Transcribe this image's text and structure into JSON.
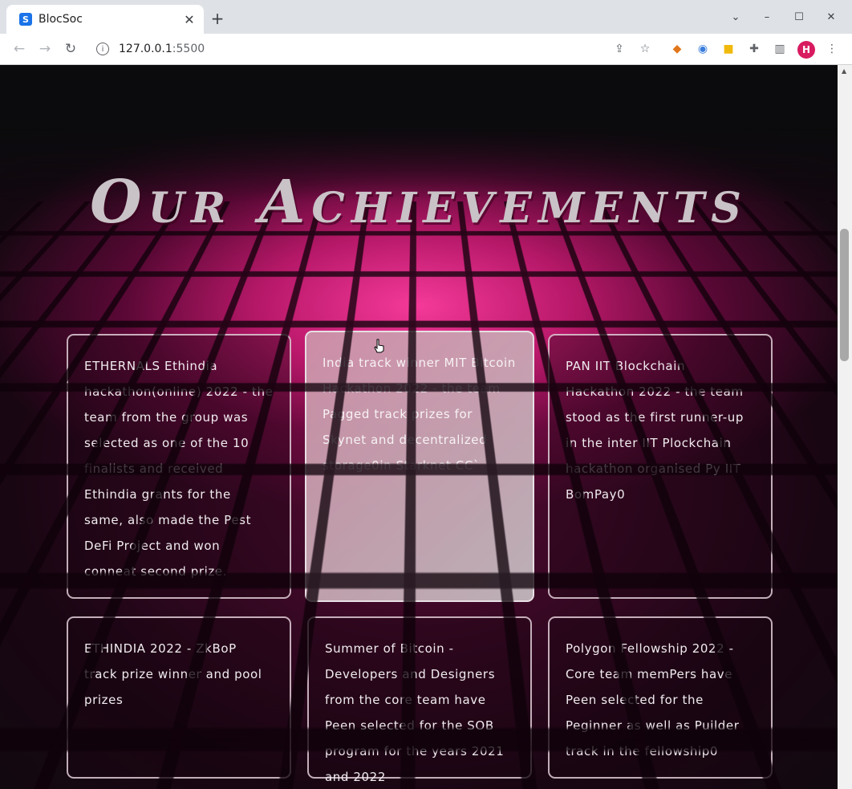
{
  "browser": {
    "tab_title": "BlocSoc",
    "tab_favicon_letter": "S",
    "url_host": "127.0.0.1",
    "url_port": ":5500",
    "profile_initial": "H",
    "icons": {
      "back": "arrow-left-icon",
      "forward": "arrow-right-icon",
      "reload": "reload-icon",
      "info": "info-icon",
      "share": "share-icon",
      "bookmark": "star-icon",
      "extensions": "puzzle-icon",
      "sidepanel": "side-panel-icon",
      "menu": "kebab-menu-icon"
    }
  },
  "page": {
    "heading": "Our Achievements",
    "accent_color": "#e0207a",
    "cards": [
      {
        "text": "ETHERNALS Ethindia hackathon(online) 2022 - the team from the group was selected as one of the 10 finalists and received Ethindia grants for the same, also made the Pest DeFi Project and won conneat second prize."
      },
      {
        "text": "India track winner MIT Bitcoin Hackathon 2022 - the team Pagged track prizes for Skynet and decentralized storage0in Starknet CC`"
      },
      {
        "text": "PAN IIT Blockchain Hackathon 2022 - the team stood as the first runner-up in the inter IIT Plockchain hackathon organised Py IIT BomPay0"
      },
      {
        "text": "ETHINDIA 2022 - ZkBoP track prize winner and pool prizes"
      },
      {
        "text": "Summer of Bitcoin - Developers and Designers from the core team have Peen selected for the SOB program for the years 2021 and 2022"
      },
      {
        "text": "Polygon Fellowship 2022 - Core team memPers have Peen selected for the Peginner as well as Puilder track in the fellowship0"
      }
    ]
  }
}
